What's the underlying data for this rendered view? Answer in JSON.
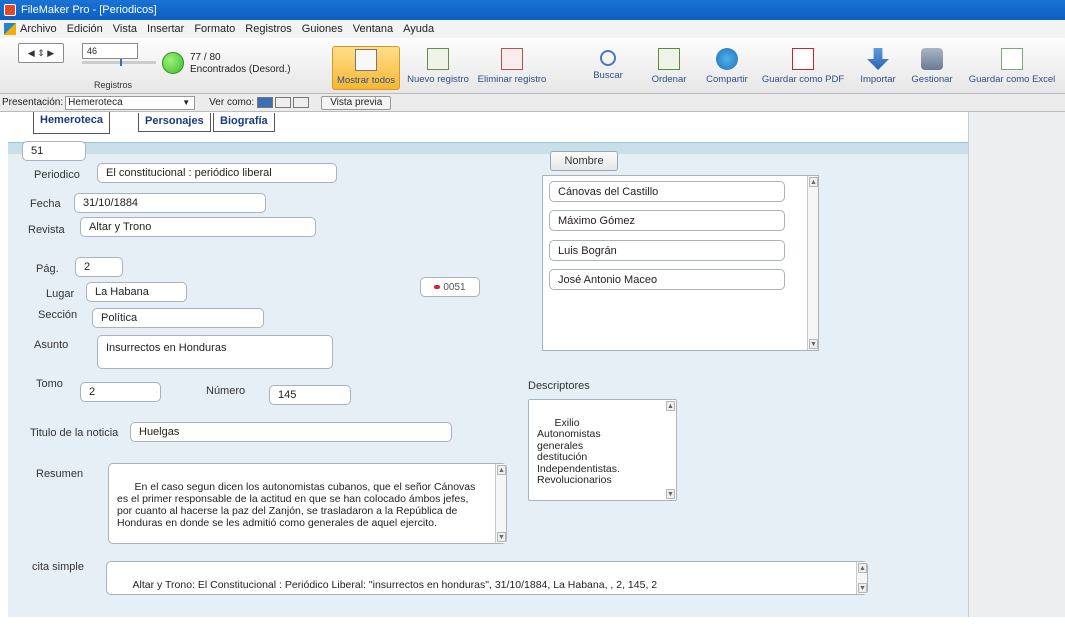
{
  "window": {
    "title": "FileMaker Pro - [Periodicos]"
  },
  "menu": [
    "Archivo",
    "Edición",
    "Vista",
    "Insertar",
    "Formato",
    "Registros",
    "Guiones",
    "Ventana",
    "Ayuda"
  ],
  "toolbar": {
    "record_number": "46",
    "records_label": "Registros",
    "found_count": "77 / 80",
    "found_status": "Encontrados (Desord.)",
    "buttons": {
      "show_all": "Mostrar todos",
      "new_record": "Nuevo registro",
      "delete_record": "Eliminar registro",
      "find": "Buscar",
      "sort": "Ordenar",
      "share": "Compartir",
      "save_pdf": "Guardar como PDF",
      "import": "Importar",
      "manage": "Gestionar",
      "save_excel": "Guardar como Excel"
    }
  },
  "layoutbar": {
    "layout_label": "Presentación:",
    "layout_value": "Hemeroteca",
    "view_as_label": "Ver como:",
    "preview_button": "Vista previa"
  },
  "tabs": [
    "Hemeroteca",
    "Personajes",
    "Biografía"
  ],
  "record": {
    "id": "51",
    "periodico_label": "Periodico",
    "periodico": "El constitucional : periódico liberal",
    "fecha_label": "Fecha",
    "fecha": "31/10/1884",
    "revista_label": "Revista",
    "revista": "Altar y Trono",
    "pag_label": "Pág.",
    "pag": "2",
    "lugar_label": "Lugar",
    "lugar": "La Habana",
    "seccion_label": "Sección",
    "seccion": "Política",
    "asunto_label": "Asunto",
    "asunto": "Insurrectos en Honduras",
    "tomo_label": "Tomo",
    "tomo": "2",
    "numero_label": "Número",
    "numero": "145",
    "titulo_label": "Titulo de la noticia",
    "titulo": "Huelgas",
    "resumen_label": "Resumen",
    "resumen": "En el caso segun dicen los autonomistas cubanos, que el señor Cánovas es el primer responsable de la actitud en que se han colocado ámbos jefes, por cuanto al hacerse la paz del Zanjón, se trasladaron a la República de Honduras en donde se les admitió como generales de aquel ejercito.",
    "cita_label": "cita simple",
    "cita": "Altar y Trono: El Constitucional : Periódico Liberal: \"insurrectos en honduras\", 31/10/1884, La Habana, , 2, 145, 2",
    "code": "0051"
  },
  "personajes": {
    "header_button": "Nombre",
    "items": [
      "Cánovas del Castillo",
      "Máximo Gómez",
      "Luis Bográn",
      "José Antonio Maceo"
    ]
  },
  "descriptores": {
    "label": "Descriptores",
    "text": "Exilio\nAutonomistas\ngenerales\ndestitución\nIndependentistas.\nRevolucionarios"
  },
  "colors": {
    "form_bg": "#e6eff6",
    "tab_line": "#c9e0ea",
    "show_all_active": "#f6b733",
    "title_bar": "#1a73d6"
  }
}
